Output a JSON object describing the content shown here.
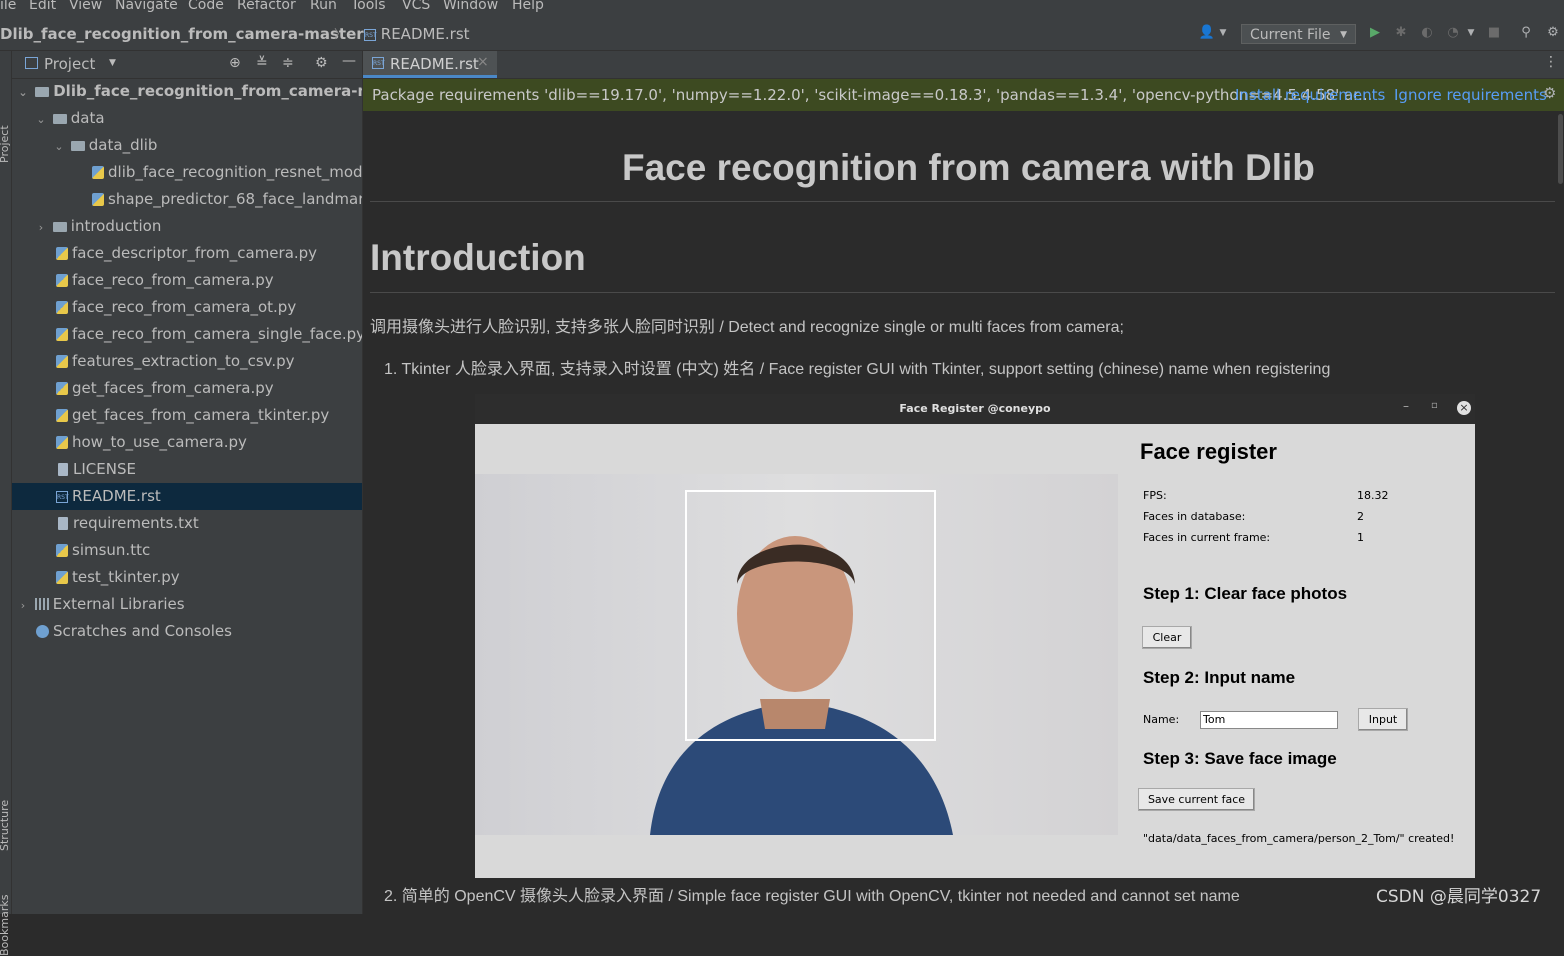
{
  "menu": [
    "ile",
    "Edit",
    "View",
    "Navigate",
    "Code",
    "Refactor",
    "Run",
    "Tools",
    "VCS",
    "Window",
    "Help"
  ],
  "nav": {
    "project_name": "Dlib_face_recognition_from_camera-master",
    "file": "README.rst",
    "run_config": "Current File"
  },
  "side_tabs": {
    "project": "Project",
    "structure": "Structure",
    "bookmarks": "Bookmarks"
  },
  "project_panel": {
    "title": "Project",
    "tree": [
      {
        "label": "Dlib_face_recognition_from_camera-ma",
        "type": "folder",
        "expanded": true
      },
      {
        "label": "data",
        "type": "folder",
        "expanded": true
      },
      {
        "label": "data_dlib",
        "type": "folder",
        "expanded": true
      },
      {
        "label": "dlib_face_recognition_resnet_mode",
        "type": "file"
      },
      {
        "label": "shape_predictor_68_face_landmarks",
        "type": "file"
      },
      {
        "label": "introduction",
        "type": "folder",
        "expanded": false
      },
      {
        "label": "face_descriptor_from_camera.py",
        "type": "py"
      },
      {
        "label": "face_reco_from_camera.py",
        "type": "py"
      },
      {
        "label": "face_reco_from_camera_ot.py",
        "type": "py"
      },
      {
        "label": "face_reco_from_camera_single_face.py",
        "type": "py"
      },
      {
        "label": "features_extraction_to_csv.py",
        "type": "py"
      },
      {
        "label": "get_faces_from_camera.py",
        "type": "py"
      },
      {
        "label": "get_faces_from_camera_tkinter.py",
        "type": "py"
      },
      {
        "label": "how_to_use_camera.py",
        "type": "py"
      },
      {
        "label": "LICENSE",
        "type": "text"
      },
      {
        "label": "README.rst",
        "type": "rst",
        "selected": true
      },
      {
        "label": "requirements.txt",
        "type": "text"
      },
      {
        "label": "simsun.ttc",
        "type": "py"
      },
      {
        "label": "test_tkinter.py",
        "type": "py"
      },
      {
        "label": "External Libraries",
        "type": "lib",
        "expanded": false
      },
      {
        "label": "Scratches and Consoles",
        "type": "scratch"
      }
    ]
  },
  "editor_tab": {
    "label": "README.rst",
    "close": "×"
  },
  "banner": {
    "message": "Package requirements 'dlib==19.17.0', 'numpy==1.22.0', 'scikit-image==0.18.3', 'pandas==1.3.4', 'opencv-python==4.5.4.58' ar...",
    "install": "Install requirements",
    "ignore": "Ignore requirements"
  },
  "doc": {
    "title": "Face recognition from camera with Dlib",
    "section": "Introduction",
    "intro": "调用摄像头进行人脸识别, 支持多张人脸同时识别 / Detect and recognize single or multi faces from camera;",
    "item1": "1. Tkinter 人脸录入界面, 支持录入时设置 (中文) 姓名 / Face register GUI with Tkinter, support setting (chinese) name when registering",
    "item2": "2. 简单的 OpenCV 摄像头人脸录入界面 / Simple face register GUI with OpenCV, tkinter not needed and cannot set name"
  },
  "face_register": {
    "window_title": "Face Register @coneypo",
    "heading": "Face register",
    "fps_label": "FPS:",
    "fps_value": "18.32",
    "db_label": "Faces in database:",
    "db_value": "2",
    "frame_label": "Faces in current frame:",
    "frame_value": "1",
    "step1": "Step 1: Clear face photos",
    "clear_btn": "Clear",
    "step2": "Step 2: Input name",
    "name_label": "Name:",
    "name_value": "Tom",
    "input_btn": "Input",
    "step3": "Step 3: Save face image",
    "save_btn": "Save current face",
    "status": "\"data/data_faces_from_camera/person_2_Tom/\" created!"
  },
  "watermark": "CSDN @晨同学0327"
}
